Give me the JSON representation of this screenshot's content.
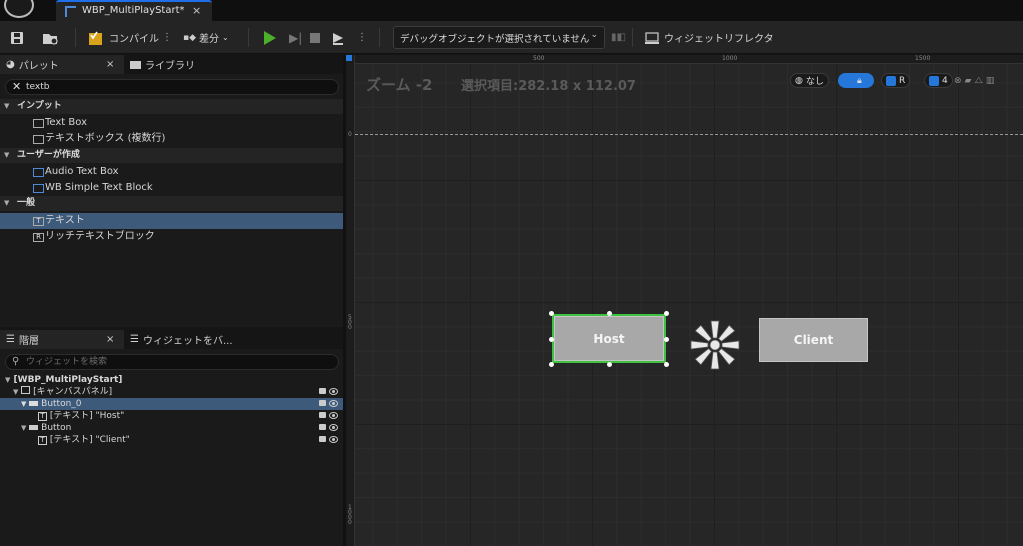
{
  "window": {
    "tab_title": "WBP_MultiPlayStart*",
    "tab_close": "×"
  },
  "toolbar": {
    "compile_label": "コンパイル",
    "diff_label": "差分",
    "debug_select": "デバッグオブジェクトが選択されていません",
    "widget_reflector_label": "ウィジェットリフレクタ"
  },
  "palette": {
    "tab_palette": "パレット",
    "tab_close": "×",
    "tab_library": "ライブラリ",
    "search_value": "textb",
    "categories": [
      {
        "label": "インプット",
        "items": [
          "Text Box",
          "テキストボックス (複数行)"
        ]
      },
      {
        "label": "ユーザーが作成",
        "items": [
          "Audio Text Box",
          "WB Simple Text Block"
        ]
      },
      {
        "label": "一般",
        "items": [
          "テキスト",
          "リッチテキストブロック"
        ]
      }
    ]
  },
  "hierarchy": {
    "tab_hierarchy": "階層",
    "tab_close": "×",
    "tab_bind": "ウィジェットをバ...",
    "search_placeholder": "ウィジェットを検索",
    "tree": [
      "[WBP_MultiPlayStart]",
      "[キャンバスパネル]",
      "Button_0",
      "[テキスト] \"Host\"",
      "Button",
      "[テキスト] \"Client\""
    ]
  },
  "canvas": {
    "zoom_label": "ズーム -2",
    "selection_label": "選択項目:282.18 x 112.07",
    "none_label": "なし",
    "r_label": "R",
    "grid_value": "4",
    "ruler_top": [
      "500",
      "1000",
      "1500"
    ],
    "ruler_left": [
      "0",
      "5 0 0",
      "1 0 0 0"
    ],
    "host_button": "Host",
    "client_button": "Client"
  },
  "colors": {
    "selection_outline": "#3fc23f",
    "play_green": "#4caf2a",
    "accent_blue": "#2577d9",
    "selected_row": "#3d5a7a"
  }
}
